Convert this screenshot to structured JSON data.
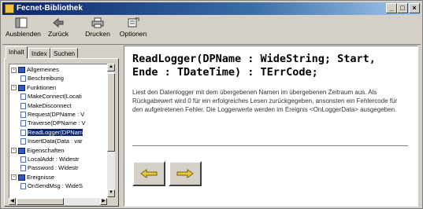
{
  "window": {
    "title": "Fecnet-Bibliothek",
    "min": "_",
    "max": "□",
    "close": "×"
  },
  "toolbar": [
    {
      "name": "ausblenden-button",
      "icon": "hide-pane-icon",
      "label": "Ausblenden"
    },
    {
      "name": "zurueck-button",
      "icon": "back-arrow-icon",
      "label": "Zurück"
    },
    {
      "name": "drucken-button",
      "icon": "printer-icon",
      "label": "Drucken"
    },
    {
      "name": "optionen-button",
      "icon": "options-icon",
      "label": "Optionen"
    }
  ],
  "tabs": [
    "Inhalt",
    "Index",
    "Suchen"
  ],
  "tree": [
    {
      "level": 0,
      "type": "book",
      "pm": "-",
      "label": "Allgemeines"
    },
    {
      "level": 1,
      "type": "page",
      "label": "Beschreibung"
    },
    {
      "level": 0,
      "type": "book",
      "pm": "-",
      "label": "Funktionen"
    },
    {
      "level": 1,
      "type": "page",
      "label": "MakeConnect(Locati"
    },
    {
      "level": 1,
      "type": "page",
      "label": "MakeDisconnect"
    },
    {
      "level": 1,
      "type": "page",
      "label": "Request(DPName : V"
    },
    {
      "level": 1,
      "type": "page",
      "label": "Traverse(DPName : V"
    },
    {
      "level": 1,
      "type": "page",
      "label": "ReadLogger(DPNam",
      "selected": true
    },
    {
      "level": 1,
      "type": "page",
      "label": "InsertData(Data : var"
    },
    {
      "level": 0,
      "type": "book",
      "pm": "-",
      "label": "Eigenschaften"
    },
    {
      "level": 1,
      "type": "page",
      "label": "LocalAddr : Widestr"
    },
    {
      "level": 1,
      "type": "page",
      "label": "Password : Widestr"
    },
    {
      "level": 0,
      "type": "book",
      "pm": "-",
      "label": "Ereignisse"
    },
    {
      "level": 1,
      "type": "page",
      "label": "OnSendMsg : WideS"
    }
  ],
  "content": {
    "heading": "ReadLogger(DPName : WideString; Start, Ende : TDateTime) : TErrCode;",
    "body": "Liest den Datenlogger mit dem übergebenen Namen im übergebenen Zeitraum aus. Als Rückgabewert wird 0 für ein erfolgreiches Lesen zurückgegeben, ansonsten ein Fehlercode für den aufgetretenen Fehler. Die Loggerwerte werden im Ereignis <OnLoggerData> ausgegeben."
  },
  "colors": {
    "titlebar": "#0a246a",
    "selection": "#0a246a",
    "face": "#d4d0c8",
    "arrow": "#e0c040"
  }
}
